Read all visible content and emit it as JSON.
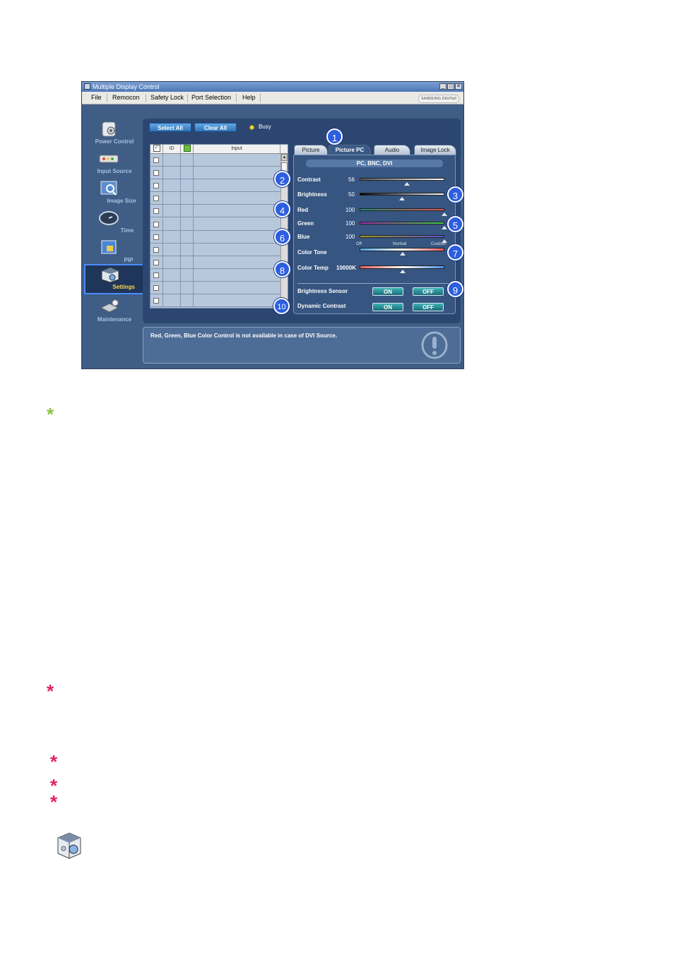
{
  "window": {
    "title": "Multiple Display Control",
    "controls": {
      "minimize": "_",
      "maximize": "□",
      "close": "✕"
    }
  },
  "menu": {
    "items": [
      "File",
      "Remocon",
      "Safety Lock",
      "Port Selection",
      "Help"
    ],
    "brand": "SAMSUNG DIGITall"
  },
  "sidebar": {
    "items": [
      {
        "label": "Power Control",
        "icon": "power-control-icon"
      },
      {
        "label": "Input Source",
        "icon": "input-source-icon"
      },
      {
        "label": "Image Size",
        "icon": "image-size-icon"
      },
      {
        "label": "Time",
        "icon": "clock-icon"
      },
      {
        "label": "PIP",
        "icon": "pip-icon"
      },
      {
        "label": "Settings",
        "icon": "settings-cube-icon",
        "active": true
      },
      {
        "label": "Maintenance",
        "icon": "maintenance-icon"
      }
    ]
  },
  "toolbar": {
    "select_all": "Select All",
    "clear_all": "Clear All",
    "busy": "Busy"
  },
  "grid": {
    "columns": [
      "",
      "ID",
      "",
      "Input"
    ],
    "row_count": 12
  },
  "tabs": [
    {
      "label": "Picture",
      "active": false
    },
    {
      "label": "Picture PC",
      "active": true
    },
    {
      "label": "Audio",
      "active": false
    },
    {
      "label": "Image Lock",
      "active": false
    }
  ],
  "picture_pc": {
    "source": "PC, BNC, DVI",
    "contrast": {
      "label": "Contrast",
      "value": "56",
      "level": 56
    },
    "brightness": {
      "label": "Brightness",
      "value": "50",
      "level": 50
    },
    "red": {
      "label": "Red",
      "value": "100",
      "level": 100
    },
    "green": {
      "label": "Green",
      "value": "100",
      "level": 100
    },
    "blue": {
      "label": "Blue",
      "value": "100",
      "level": 100
    },
    "color_tone": {
      "label": "Color Tone",
      "options": [
        "Off",
        "Normal",
        "Custom"
      ],
      "selected": "Normal"
    },
    "color_temp": {
      "label": "Color Temp",
      "value": "10000K"
    },
    "brightness_sensor": {
      "label": "Brightness Sensor",
      "on": "ON",
      "off": "OFF"
    },
    "dynamic_contrast": {
      "label": "Dynamic Contrast",
      "on": "ON",
      "off": "OFF"
    }
  },
  "message": "Red, Green, Blue Color Control is not available in case of DVI Source.",
  "callouts": [
    "1",
    "2",
    "3",
    "4",
    "5",
    "6",
    "7",
    "8",
    "9",
    "10"
  ],
  "colors": {
    "window_bg": "#3f5d85",
    "panel_bg": "#2b4670",
    "tab_panel_bg": "#365580",
    "callout": "#2d5ee0",
    "note_star_green": "#8ac441",
    "note_star_red": "#e4235a"
  }
}
